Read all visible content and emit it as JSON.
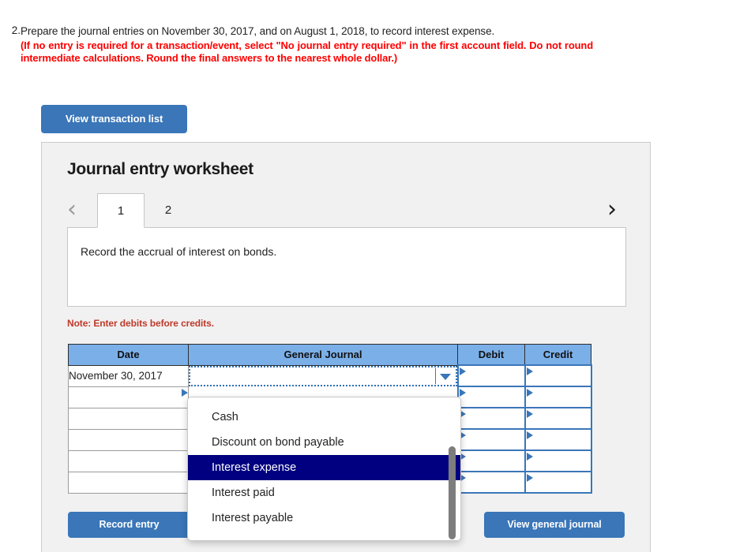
{
  "question": {
    "number": "2.",
    "lead": "Prepare the journal entries on November 30, 2017, and on August 1, 2018, to record interest expense.",
    "instruction": "(If no entry is required for a transaction/event, select \"No journal entry required\" in the first account field. Do not round intermediate calculations. Round the final answers to the nearest whole dollar.)"
  },
  "toolbar": {
    "view_transaction_list_label": "View transaction list"
  },
  "worksheet": {
    "title": "Journal entry worksheet",
    "tabs": [
      {
        "label": "1",
        "active": true
      },
      {
        "label": "2",
        "active": false
      }
    ],
    "prev_icon": "chevron-left-icon",
    "next_icon": "chevron-right-icon",
    "description": "Record the accrual of interest on bonds.",
    "note": "Note: Enter debits before credits.",
    "note_color": "#c0392b"
  },
  "table": {
    "headers": [
      "Date",
      "General Journal",
      "Debit",
      "Credit"
    ],
    "header_bg": "#7bafe8",
    "rows": [
      {
        "date": "November 30, 2017",
        "general_journal": "",
        "debit": "",
        "credit": ""
      },
      {
        "date": "",
        "general_journal": "",
        "debit": "",
        "credit": ""
      },
      {
        "date": "",
        "general_journal": "",
        "debit": "",
        "credit": ""
      },
      {
        "date": "",
        "general_journal": "",
        "debit": "",
        "credit": ""
      },
      {
        "date": "",
        "general_journal": "",
        "debit": "",
        "credit": ""
      },
      {
        "date": "",
        "general_journal": "",
        "debit": "",
        "credit": ""
      }
    ]
  },
  "dropdown": {
    "options": [
      "Cash",
      "Discount on bond payable",
      "Interest expense",
      "Interest paid",
      "Interest payable"
    ],
    "selected": "Interest expense",
    "selected_bg": "#000080"
  },
  "buttons": {
    "record_entry_label": "Record entry",
    "view_general_journal_label": "View general journal",
    "add_row_label": "",
    "accent": "#3a76b8"
  }
}
